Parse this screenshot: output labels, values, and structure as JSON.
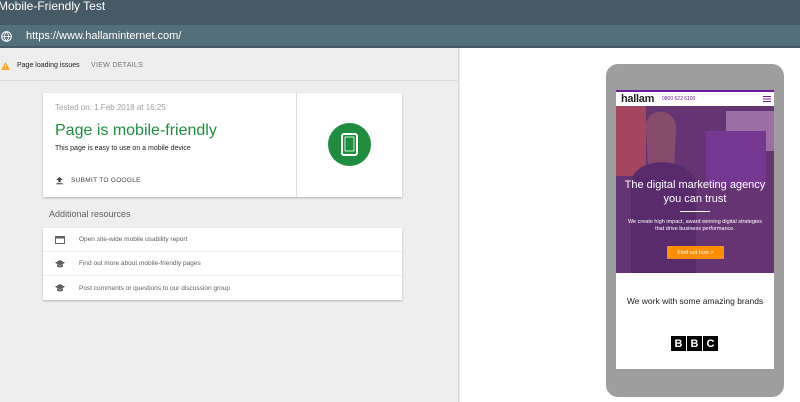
{
  "app": {
    "title": "Mobile-Friendly Test"
  },
  "urlbar": {
    "url": "https://www.hallaminternet.com/"
  },
  "issues": {
    "text": "Page loading issues",
    "details_label": "VIEW DETAILS"
  },
  "result": {
    "tested_on": "Tested on: 1 Feb 2018 at 16:25",
    "heading": "Page is mobile-friendly",
    "subtext": "This page is easy to use on a mobile device",
    "submit_label": "SUBMIT TO GOOGLE"
  },
  "resources": {
    "title": "Additional resources",
    "items": [
      {
        "label": "Open site-wide mobile usability report",
        "icon": "report-icon"
      },
      {
        "label": "Find out more about mobile-friendly pages",
        "icon": "school-icon"
      },
      {
        "label": "Post comments or questions to our discussion group",
        "icon": "school-icon"
      }
    ]
  },
  "preview": {
    "logo": "hallam",
    "phone": "0800 622 6100",
    "hero_title": "The digital marketing agency you can trust",
    "hero_text": "We create high impact, award winning digital strategies that drive business performance.",
    "hero_button": "Find out how  >",
    "brands_title": "We work with some amazing brands",
    "brand_logo": [
      "B",
      "B",
      "C"
    ]
  },
  "colors": {
    "topbar": "#455a64",
    "urlbar": "#546e7a",
    "success": "#1e8e3e",
    "accent_purple": "#6a1b9a",
    "cta_orange": "#ff8f00"
  }
}
